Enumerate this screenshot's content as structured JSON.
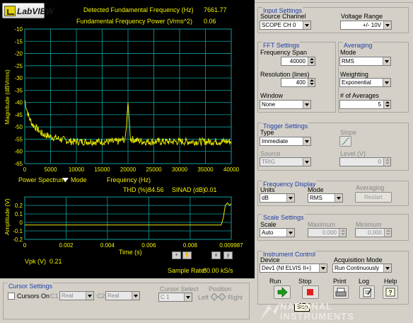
{
  "header": {
    "app_name": "LabVIEW",
    "fundamental_freq_label": "Detected Fundamental Frequency (Hz)",
    "fundamental_freq_value": "7661.77",
    "fundamental_power_label": "Fundamental Frequency Power (Vrms^2)",
    "fundamental_power_value": "0.06"
  },
  "spectrum_graph": {
    "ylabel": "Magnitude (dBVrms)",
    "yticks": [
      "-10",
      "-15",
      "-20",
      "-25",
      "-30",
      "-35",
      "-40",
      "-45",
      "-50",
      "-55",
      "-60",
      "-65"
    ],
    "xticks": [
      "0",
      "5000",
      "10000",
      "15000",
      "20000",
      "25000",
      "30000",
      "35000",
      "40000"
    ],
    "mode_label": "Power Spectrum",
    "mode_suffix": "Mode",
    "xlabel": "Frequency (Hz)",
    "thd_label": "THD (%)",
    "thd_value": "84.56",
    "sinad_label": "SINAD (dB)",
    "sinad_value": "0.01",
    "trace_color": "#e6e600",
    "grid_color": "#0fa0a0"
  },
  "chart_data": [
    {
      "type": "line",
      "title": "",
      "xlabel": "Frequency (Hz)",
      "ylabel": "Magnitude (dBVrms)",
      "xlim": [
        0,
        40000
      ],
      "ylim": [
        -65,
        -10
      ],
      "grid": true,
      "x": [
        0,
        300,
        800,
        1500,
        2500,
        3500,
        5000,
        7000,
        9000,
        12000,
        15000,
        18000,
        19500,
        20000,
        20500,
        23000,
        26000,
        30000,
        34000,
        38000,
        40000
      ],
      "y": [
        -39,
        -42,
        -46,
        -49,
        -51,
        -53,
        -54,
        -55,
        -56,
        -56,
        -56,
        -56,
        -55,
        -40,
        -55,
        -56,
        -56,
        -56,
        -56,
        -56,
        -56
      ]
    },
    {
      "type": "line",
      "title": "",
      "xlabel": "Time (s)",
      "ylabel": "Amplitude (V)",
      "xlim": [
        0,
        0.009987
      ],
      "ylim": [
        -0.2,
        0.3
      ],
      "grid": true,
      "x": [
        0,
        0.002,
        0.004,
        0.006,
        0.008,
        0.0095,
        0.0096,
        0.0097,
        0.0098,
        0.0099,
        0.009987
      ],
      "y": [
        -0.03,
        -0.03,
        -0.03,
        -0.03,
        -0.03,
        -0.03,
        0.05,
        0.2,
        0.23,
        0.2,
        0.22
      ]
    }
  ],
  "time_graph": {
    "ylabel": "Amplitude (V)",
    "yticks": [
      "0.2",
      "0.1",
      "0",
      "-0.1",
      "-0.2"
    ],
    "xticks": [
      "0",
      "0.002",
      "0.004",
      "0.006",
      "0.008",
      "0.009987"
    ],
    "xlabel": "Time (s)",
    "vpk_label": "Vpk (V)",
    "vpk_value": "0.21",
    "sample_rate_label": "Sample Rate:",
    "sample_rate_value": "80.00 kS/s"
  },
  "input_settings": {
    "title": "Input Settings",
    "source_channel_label": "Source Channel",
    "source_channel_value": "SCOPE CH 0",
    "voltage_range_label": "Voltage Range",
    "voltage_range_value": "+/- 10V"
  },
  "fft_settings": {
    "title": "FFT Settings",
    "frequency_span_label": "Frequency Span",
    "frequency_span_value": "40000",
    "resolution_label": "Resolution (lines)",
    "resolution_value": "400",
    "window_label": "Window",
    "window_value": "None"
  },
  "averaging": {
    "title": "Averaging",
    "mode_label": "Mode",
    "mode_value": "RMS",
    "weighting_label": "Weighting",
    "weighting_value": "Exponential",
    "num_averages_label": "# of Averages",
    "num_averages_value": "5"
  },
  "trigger_settings": {
    "title": "Trigger Settings",
    "type_label": "Type",
    "type_value": "Immediate",
    "slope_label": "Slope",
    "source_label": "Source",
    "source_value": "TRIG",
    "level_label": "Level (V)",
    "level_value": "0"
  },
  "frequency_display": {
    "title": "Frequency Display",
    "units_label": "Units",
    "units_value": "dB",
    "mode_label": "Mode",
    "mode_value": "RMS",
    "averaging_label": "Averaging",
    "restart_label": "Restart"
  },
  "scale_settings": {
    "title": "Scale Settings",
    "scale_label": "Scale",
    "scale_value": "Auto",
    "maximum_label": "Maximum",
    "maximum_value": "0.000",
    "minimum_label": "Minimum",
    "minimum_value": "0.000"
  },
  "instrument_control": {
    "title": "Instrument Control",
    "device_label": "Device",
    "device_value": "Dev1 (NI ELVIS II+)",
    "acq_mode_label": "Acquisition Mode",
    "acq_mode_value": "Run Continuously",
    "run_label": "Run",
    "stop_label": "Stop",
    "print_label": "Print",
    "log_label": "Log",
    "help_label": "Help",
    "tooltip": "Stop"
  },
  "cursor_settings": {
    "title": "Cursor Settings",
    "cursors_on_label": "Cursors On",
    "c1_label": "C1",
    "c1_value": "Real",
    "c2_label": "C2",
    "c2_value": "Real",
    "cursor_select_label": "Cursor Select",
    "cursor_select_value": "C 1",
    "position_label": "Position",
    "left_label": "Left",
    "right_label": "Right"
  },
  "brand": {
    "ni_line1": "NATIONAL",
    "ni_line2": "INSTRUMENTS"
  }
}
